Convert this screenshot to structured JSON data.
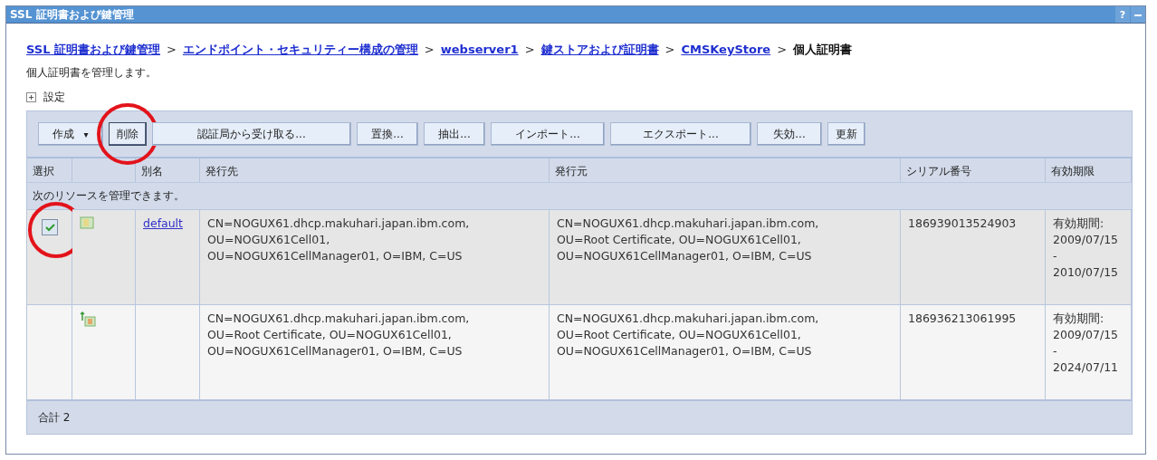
{
  "window": {
    "title": "SSL 証明書および鍵管理",
    "help": "?"
  },
  "breadcrumb": [
    {
      "label": "SSL 証明書および鍵管理",
      "link": true
    },
    {
      "label": "エンドポイント・セキュリティー構成の管理",
      "link": true
    },
    {
      "label": "webserver1",
      "link": true
    },
    {
      "label": "鍵ストアおよび証明書",
      "link": true
    },
    {
      "label": "CMSKeyStore",
      "link": true
    },
    {
      "label": "個人証明書",
      "link": false
    }
  ],
  "separator": ">",
  "description": "個人証明書を管理します。",
  "settings": {
    "label": "設定",
    "expanded": false
  },
  "toolbar": [
    {
      "label": "作成",
      "dropdown": true,
      "circled": false,
      "caret": "▾"
    },
    {
      "label": "削除",
      "dropdown": false,
      "circled": true
    },
    {
      "label": "認証局から受け取る...",
      "dropdown": false,
      "circled": false
    },
    {
      "label": "置換...",
      "dropdown": false,
      "circled": false
    },
    {
      "label": "抽出...",
      "dropdown": false,
      "circled": false
    },
    {
      "label": "インポート...",
      "dropdown": false,
      "circled": false
    },
    {
      "label": "エクスポート...",
      "dropdown": false,
      "circled": false
    },
    {
      "label": "失効...",
      "dropdown": false,
      "circled": false
    },
    {
      "label": "更新",
      "dropdown": false,
      "circled": false
    }
  ],
  "table": {
    "columns": [
      "選択",
      "",
      "別名",
      "発行先",
      "発行元",
      "シリアル番号",
      "有効期限"
    ],
    "info": "次のリソースを管理できます。",
    "rows": [
      {
        "checkbox": true,
        "checked": true,
        "circled": true,
        "kind": "personal",
        "alias": "default",
        "issued_to": "CN=NOGUX61.dhcp.makuhari.japan.ibm.com,\nOU=NOGUX61Cell01,\nOU=NOGUX61CellManager01, O=IBM, C=US",
        "issued_by": "CN=NOGUX61.dhcp.makuhari.japan.ibm.com,\nOU=Root Certificate, OU=NOGUX61Cell01,\nOU=NOGUX61CellManager01, O=IBM, C=US",
        "serial": "186939013524903",
        "validity_label": "有効期間:",
        "validity": "2009/07/15\n-\n2010/07/15"
      },
      {
        "checkbox": false,
        "checked": false,
        "circled": false,
        "kind": "signer",
        "issued_to": "CN=NOGUX61.dhcp.makuhari.japan.ibm.com,\nOU=Root Certificate, OU=NOGUX61Cell01,\nOU=NOGUX61CellManager01, O=IBM, C=US",
        "issued_by": "CN=NOGUX61.dhcp.makuhari.japan.ibm.com,\nOU=Root Certificate, OU=NOGUX61Cell01,\nOU=NOGUX61CellManager01, O=IBM, C=US",
        "serial": "186936213061995",
        "validity_label": "有効期間:",
        "validity": "2009/07/15\n-\n2024/07/11"
      }
    ],
    "total": "合計 2"
  }
}
